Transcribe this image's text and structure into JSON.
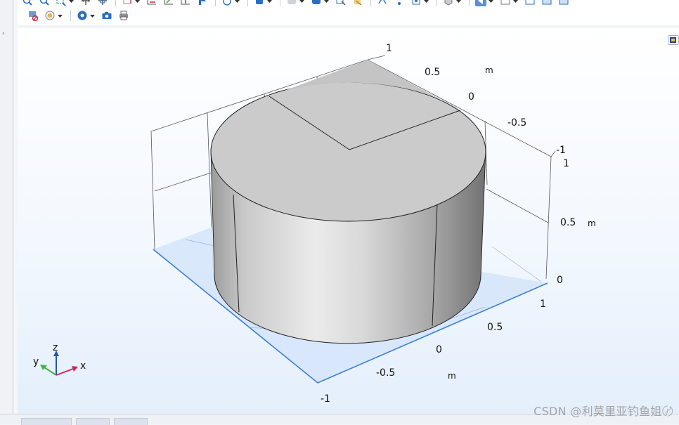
{
  "toolbar": {
    "row1_icons": [
      "zoom-in-icon",
      "zoom-out-icon",
      "zoom-box-icon",
      "zoom-extents-icon",
      "zoom-selected-icon",
      "select-box-icon",
      "move-x-icon",
      "move-y-icon",
      "move-z-icon",
      "flag-icon",
      "rotate-icon",
      "select-object-icon",
      "view-shape-icon",
      "render-icon",
      "selection-icon",
      "transparency-icon",
      "clip-icon",
      "view-list-icon",
      "vertices-icon",
      "mesh-icon",
      "perspective-icon",
      "wireframe-icon",
      "layout-icon",
      "layout-2-icon",
      "active-view-icon"
    ],
    "row2_icons": [
      "clear-selection-icon",
      "scene-light-icon",
      "views-icon",
      "camera-icon",
      "print-icon"
    ]
  },
  "graphics": {
    "y_axis_ticks": [
      "1",
      "0.5",
      "0",
      "-0.5",
      "-1"
    ],
    "y_axis_unit": "m",
    "z_axis_ticks": [
      "1",
      "0.5",
      "0"
    ],
    "z_axis_unit": "m",
    "x_axis_ticks": [
      "1",
      "0.5",
      "0",
      "-0.5",
      "-1"
    ],
    "x_axis_unit": "m",
    "triad": {
      "x": "x",
      "y": "y",
      "z": "z"
    },
    "colors": {
      "x_axis": "#d6245a",
      "y_axis": "#3fb449",
      "z_axis": "#2456a6",
      "workplane_border": "#3a7fd6"
    }
  },
  "watermark": "CSDN @利莫里亚钓鱼姐〄"
}
